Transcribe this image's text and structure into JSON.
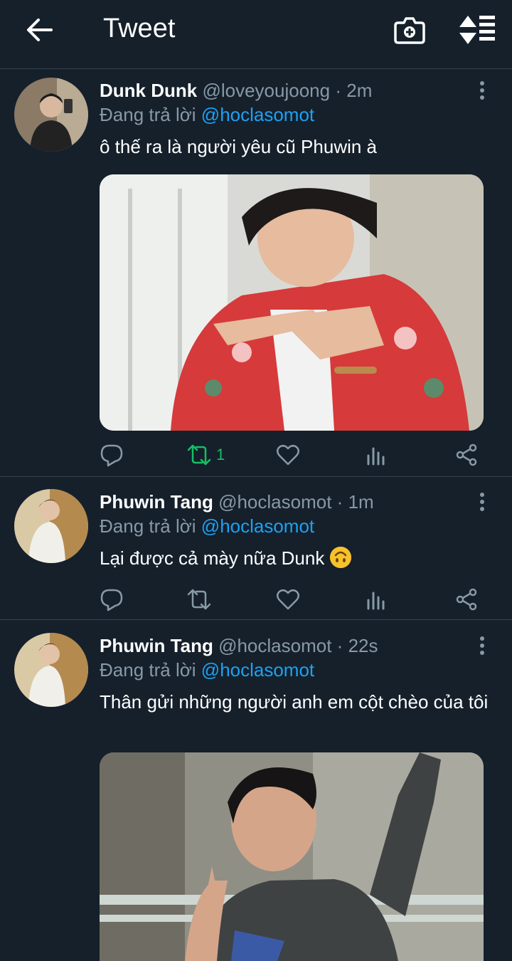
{
  "header": {
    "title": "Tweet",
    "back_icon": "arrow-left-icon",
    "camera_icon": "camera-plus-icon",
    "sort_icon": "sort-icon"
  },
  "colors": {
    "background": "#15202b",
    "divider": "#38444d",
    "secondary_text": "#8899a6",
    "mention": "#1da1f2",
    "retweet_active": "#17bf63"
  },
  "tweets": [
    {
      "name": "Dunk Dunk",
      "handle": "@loveyoujoong",
      "separator": "·",
      "time": "2m",
      "reply_prefix": "Đang trả lời",
      "reply_to": "@hoclasomot",
      "text": "ô thế ra là người yêu cũ Phuwin à",
      "has_media": true,
      "retweet_count": "1",
      "retweeted": true
    },
    {
      "name": "Phuwin Tang",
      "handle": "@hoclasomot",
      "separator": "·",
      "time": "1m",
      "reply_prefix": "Đang trả lời",
      "reply_to": "@hoclasomot",
      "text": "Lại được cả mày nữa Dunk",
      "emoji": "upside-down-face",
      "has_media": false,
      "retweet_count": "",
      "retweeted": false
    },
    {
      "name": "Phuwin Tang",
      "handle": "@hoclasomot",
      "separator": "·",
      "time": "22s",
      "reply_prefix": "Đang trả lời",
      "reply_to": "@hoclasomot",
      "text": "Thân gửi những người anh em cột chèo của tôi",
      "has_media": true
    }
  ]
}
